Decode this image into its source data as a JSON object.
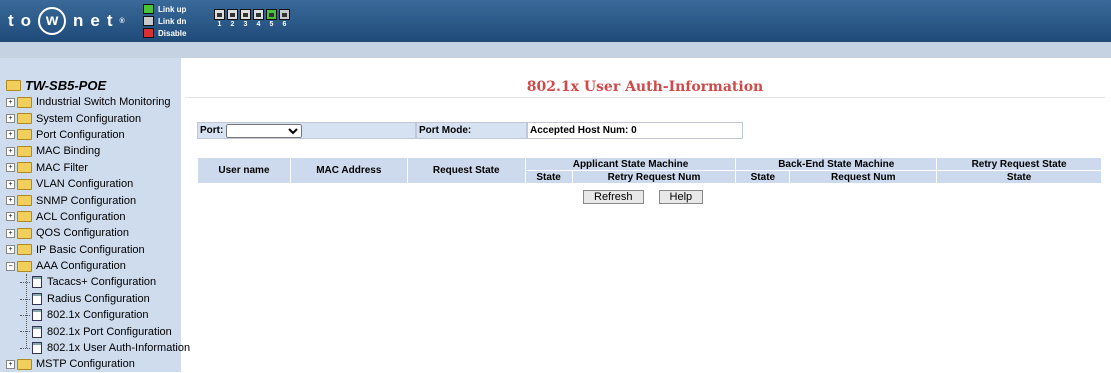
{
  "header": {
    "logo_text": "to",
    "logo_w": "w",
    "logo_rest": "net",
    "logo_tm": "®",
    "legend": [
      {
        "label": "Link up",
        "color": "#49c43a"
      },
      {
        "label": "Link dn",
        "color": "#c8c8c8"
      },
      {
        "label": "Disable",
        "color": "#d83030"
      }
    ],
    "ports": [
      "1",
      "2",
      "3",
      "4",
      "5",
      "6"
    ]
  },
  "sidebar": {
    "root": "TW-SB5-POE",
    "items": [
      "Industrial Switch Monitoring",
      "System Configuration",
      "Port Configuration",
      "MAC Binding",
      "MAC Filter",
      "VLAN Configuration",
      "SNMP Configuration",
      "ACL Configuration",
      "QOS Configuration",
      "IP Basic Configuration",
      "AAA Configuration"
    ],
    "aaa_children": [
      "Tacacs+ Configuration",
      "Radius Configuration",
      "802.1x Configuration",
      "802.1x Port Configuration",
      "802.1x User Auth-Information"
    ],
    "after": "MSTP Configuration"
  },
  "main": {
    "title": "802.1x User Auth-Information",
    "port_label": "Port:",
    "port_value": "",
    "port_mode_label": "Port Mode:",
    "accepted_label": "Accepted Host Num: 0",
    "table": {
      "user_name": "User name",
      "mac_address": "MAC Address",
      "request_state": "Request State",
      "applicant": "Applicant State Machine",
      "backend": "Back-End State Machine",
      "retry_state": "Retry Request State",
      "sub_state": "State",
      "retry_num": "Retry Request Num",
      "request_num": "Request Num"
    },
    "refresh": "Refresh",
    "help": "Help"
  }
}
